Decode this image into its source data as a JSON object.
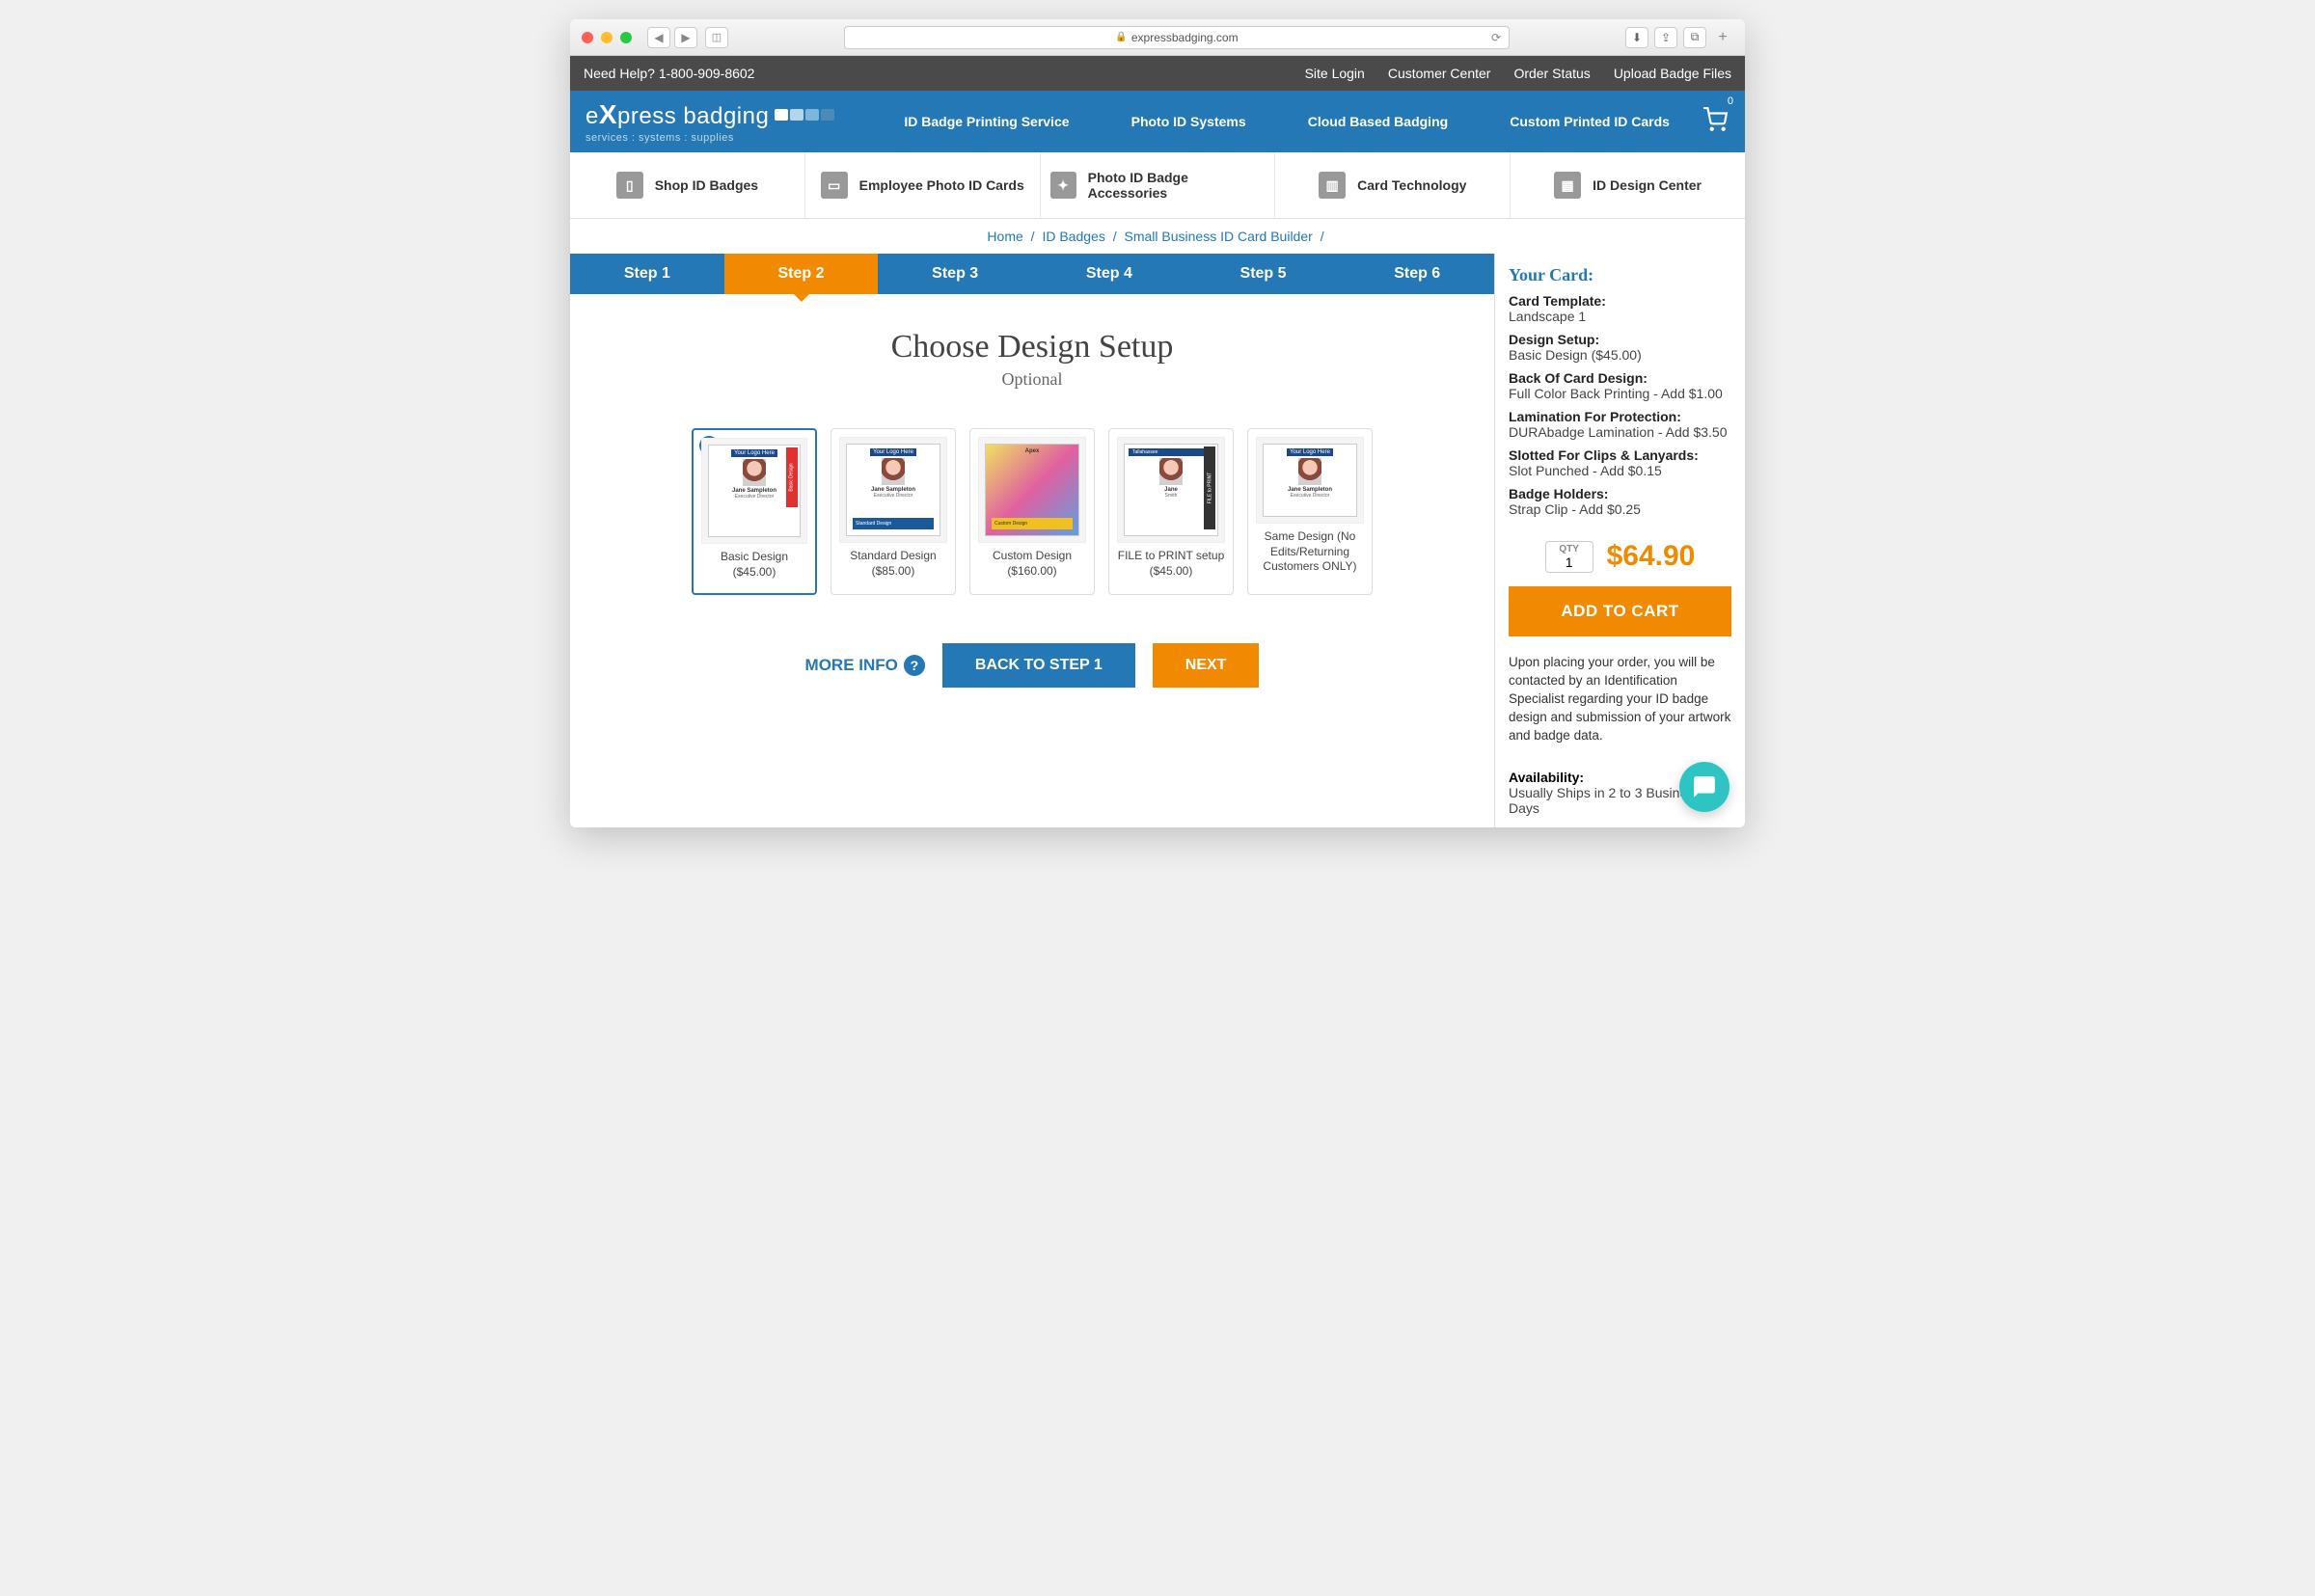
{
  "browser": {
    "url_host": "expressbadging.com"
  },
  "helpbar": {
    "need_help": "Need Help? 1-800-909-8602",
    "links": [
      "Site Login",
      "Customer Center",
      "Order Status",
      "Upload Badge Files"
    ]
  },
  "header": {
    "logo_main": "e",
    "logo_x": "X",
    "logo_rest": "press badging",
    "logo_sub": "services : systems : supplies",
    "nav": [
      "ID Badge Printing Service",
      "Photo ID Systems",
      "Cloud Based Badging",
      "Custom Printed ID Cards"
    ],
    "cart_count": "0"
  },
  "categories": [
    "Shop ID Badges",
    "Employee Photo ID Cards",
    "Photo ID Badge Accessories",
    "Card Technology",
    "ID Design Center"
  ],
  "breadcrumb": [
    "Home",
    "ID Badges",
    "Small Business ID Card Builder"
  ],
  "steps": [
    "Step 1",
    "Step 2",
    "Step 3",
    "Step 4",
    "Step 5",
    "Step 6"
  ],
  "active_step_index": 1,
  "section": {
    "title": "Choose Design Setup",
    "subtitle": "Optional"
  },
  "options": [
    {
      "label": "Basic Design ($45.00)",
      "selected": true,
      "mock_name": "Jane Sampleton",
      "mock_title": "Executive Director",
      "style": "basic"
    },
    {
      "label": "Standard Design ($85.00)",
      "selected": false,
      "mock_name": "Jane Sampleton",
      "mock_title": "Executive Director",
      "style": "standard"
    },
    {
      "label": "Custom Design ($160.00)",
      "selected": false,
      "mock_name": "",
      "mock_title": "",
      "style": "custom"
    },
    {
      "label": "FILE to PRINT setup ($45.00)",
      "selected": false,
      "mock_name": "Jane",
      "mock_title": "Smith",
      "style": "file"
    },
    {
      "label": "Same Design (No Edits/Returning Customers ONLY)",
      "selected": false,
      "mock_name": "Jane Sampleton",
      "mock_title": "Executive Director",
      "style": "same"
    }
  ],
  "actions": {
    "more_info": "MORE INFO",
    "back": "BACK TO STEP 1",
    "next": "NEXT"
  },
  "summary": {
    "heading": "Your Card:",
    "fields": [
      {
        "label": "Card Template:",
        "value": "Landscape 1"
      },
      {
        "label": "Design Setup:",
        "value": "Basic Design ($45.00)"
      },
      {
        "label": "Back Of Card Design:",
        "value": "Full Color Back Printing - Add $1.00"
      },
      {
        "label": "Lamination For Protection:",
        "value": "DURAbadge Lamination - Add $3.50"
      },
      {
        "label": "Slotted For Clips & Lanyards:",
        "value": "Slot Punched - Add $0.15"
      },
      {
        "label": "Badge Holders:",
        "value": "Strap Clip - Add $0.25"
      }
    ],
    "qty_label": "QTY",
    "qty_value": "1",
    "price": "$64.90",
    "add_to_cart": "ADD TO CART",
    "note": "Upon placing your order, you will be contacted by an Identification Specialist regarding your ID badge design and submission of your artwork and badge data.",
    "availability_label": "Availability:",
    "availability_value": "Usually Ships in 2 to 3 Business Days"
  },
  "mock_logo_text": "Your Logo Here",
  "mock_bar_labels": {
    "basic": "Basic Design",
    "standard": "Standard Design",
    "custom": "Custom Design",
    "file": "FILE to PRINT",
    "tallahassee": "Tallahassee"
  }
}
